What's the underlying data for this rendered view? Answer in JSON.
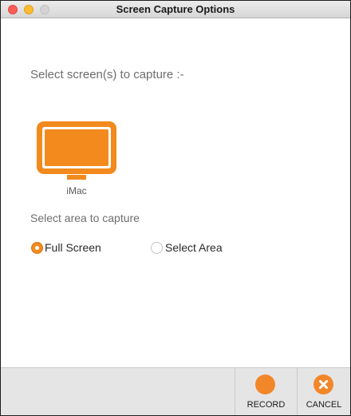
{
  "window": {
    "title": "Screen Capture Options"
  },
  "screens": {
    "heading": "Select screen(s) to capture :-",
    "items": [
      {
        "label": "iMac",
        "icon": "monitor-icon",
        "selected": true
      }
    ]
  },
  "area": {
    "heading": "Select area to capture",
    "options": [
      {
        "label": "Full Screen",
        "selected": true
      },
      {
        "label": "Select Area",
        "selected": false
      }
    ]
  },
  "footer": {
    "record_label": "RECORD",
    "cancel_label": "CANCEL"
  },
  "colors": {
    "accent": "#f28a1e",
    "close": "#fc5f57",
    "minimize": "#fdbc2e",
    "zoom_disabled": "#d3d3d3",
    "footer_bg": "#e5e5e5"
  }
}
